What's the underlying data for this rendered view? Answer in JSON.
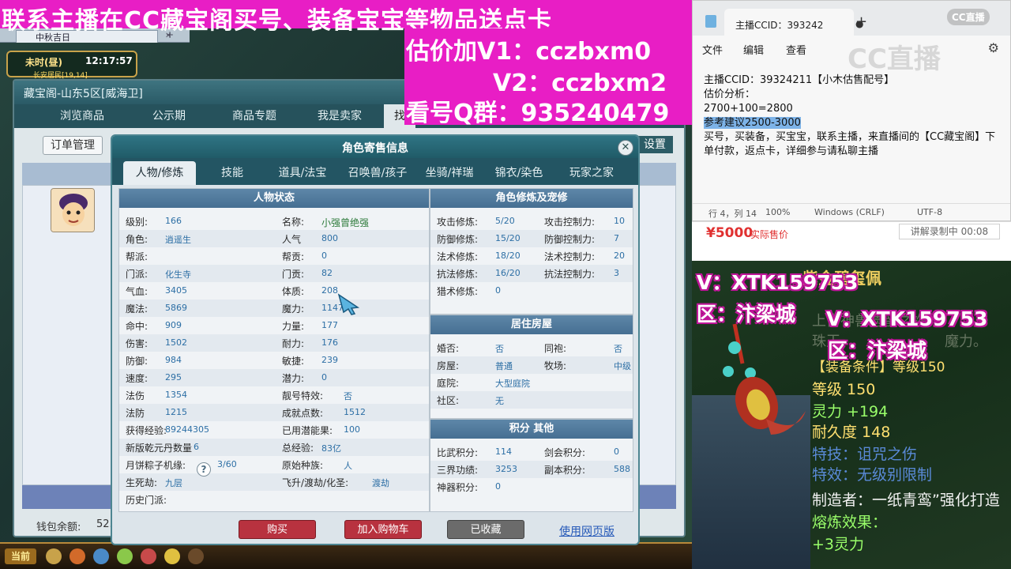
{
  "banner": {
    "title": "联系主播在CC藏宝阁买号、装备宝宝等物品送点卡",
    "price_v1": "估价加V1：cczbxm0",
    "price_v2": "V2：cczbxm2",
    "qq_group": "看号Q群：935240479"
  },
  "game": {
    "client_tab": "中秋吉日",
    "clock_period": "未时(昼)",
    "clock_time": "12:17:57",
    "location": "长安居民[19,14]",
    "market": {
      "title": "藏宝阁-山东5区[威海卫]",
      "tabs": [
        "浏览商品",
        "公示期",
        "商品专题",
        "我是卖家",
        "找"
      ],
      "order_button": "订单管理",
      "settings_button": "设置",
      "wallet_label": "钱包余额:",
      "wallet_value": "52."
    },
    "hud_now": "当前",
    "hud_colors": [
      "#c8a24a",
      "#d26a2a",
      "#4a8ac8",
      "#8ac84a",
      "#c84a4a",
      "#e0c040",
      "#6a4a2a"
    ]
  },
  "dialog": {
    "title": "角色寄售信息",
    "tabs": [
      "人物/修炼",
      "技能",
      "道具/法宝",
      "召唤兽/孩子",
      "坐骑/祥瑞",
      "锦衣/染色",
      "玩家之家"
    ],
    "status_title": "人物状态",
    "status_left": [
      {
        "label": "级别:",
        "value": "166"
      },
      {
        "label": "角色:",
        "value": "逍遥生"
      },
      {
        "label": "帮派:",
        "value": ""
      },
      {
        "label": "门派:",
        "value": "化生寺"
      },
      {
        "label": "气血:",
        "value": "3405"
      },
      {
        "label": "魔法:",
        "value": "5869"
      },
      {
        "label": "命中:",
        "value": "909"
      },
      {
        "label": "伤害:",
        "value": "1502"
      },
      {
        "label": "防御:",
        "value": "984"
      },
      {
        "label": "速度:",
        "value": "295"
      },
      {
        "label": "法伤",
        "value": "1354"
      },
      {
        "label": "法防",
        "value": "1215"
      },
      {
        "label": "获得经验:",
        "value": "89244305"
      },
      {
        "label": "新版乾元丹数量",
        "value": "6"
      },
      {
        "label": "月饼粽子机缘:",
        "value": "3/60"
      },
      {
        "label": "生死劫:",
        "value": "九层"
      },
      {
        "label": "历史门派:",
        "value": ""
      }
    ],
    "status_right": [
      {
        "label": "名称:",
        "value": "小强曾绝强"
      },
      {
        "label": "人气",
        "value": "800"
      },
      {
        "label": "帮贡:",
        "value": "0"
      },
      {
        "label": "门贡:",
        "value": "82"
      },
      {
        "label": "体质:",
        "value": "208"
      },
      {
        "label": "魔力:",
        "value": "1147"
      },
      {
        "label": "力量:",
        "value": "177"
      },
      {
        "label": "耐力:",
        "value": "176"
      },
      {
        "label": "敏捷:",
        "value": "239"
      },
      {
        "label": "潜力:",
        "value": "0"
      },
      {
        "label": "靓号特效:",
        "value": "否"
      },
      {
        "label": "成就点数:",
        "value": "1512"
      },
      {
        "label": "已用潜能果:",
        "value": "100"
      },
      {
        "label": "总经验:",
        "value": "83亿"
      },
      {
        "label": "原始种族:",
        "value": "人"
      },
      {
        "label": "飞升/渡劫/化圣:",
        "value": "渡劫"
      }
    ],
    "cultivation_title": "角色修炼及宠修",
    "cultivation": [
      {
        "l1": "攻击修炼:",
        "v1": "5/20",
        "l2": "攻击控制力:",
        "v2": "10"
      },
      {
        "l1": "防御修炼:",
        "v1": "15/20",
        "l2": "防御控制力:",
        "v2": "7"
      },
      {
        "l1": "法术修炼:",
        "v1": "18/20",
        "l2": "法术控制力:",
        "v2": "20"
      },
      {
        "l1": "抗法修炼:",
        "v1": "16/20",
        "l2": "抗法控制力:",
        "v2": "3"
      },
      {
        "l1": "猎术修炼:",
        "v1": "0",
        "l2": "",
        "v2": ""
      }
    ],
    "house_title": "居住房屋",
    "house": [
      {
        "l1": "婚否:",
        "v1": "否",
        "l2": "同袍:",
        "v2": "否"
      },
      {
        "l1": "房屋:",
        "v1": "普通",
        "l2": "牧场:",
        "v2": "中级"
      },
      {
        "l1": "庭院:",
        "v1": "大型庭院",
        "l2": "",
        "v2": ""
      },
      {
        "l1": "社区:",
        "v1": "无",
        "l2": "",
        "v2": ""
      }
    ],
    "points_title": "积分 其他",
    "points": [
      {
        "l1": "比武积分:",
        "v1": "114",
        "l2": "剑会积分:",
        "v2": "0"
      },
      {
        "l1": "三界功绩:",
        "v1": "3253",
        "l2": "副本积分:",
        "v2": "588"
      },
      {
        "l1": "神器积分:",
        "v1": "0",
        "l2": "",
        "v2": ""
      }
    ],
    "buy": "购买",
    "add_cart": "加入购物车",
    "favorited": "已收藏",
    "web_version": "使用网页版"
  },
  "notepad": {
    "tab_title": "主播CCID：393242",
    "menu": [
      "文件",
      "编辑",
      "查看"
    ],
    "logo": "CC直播",
    "watermark": "CC直播",
    "lines": [
      "主播CCID：39324211【小木估售配号】",
      "估价分析：",
      "2700+100=2800",
      "参考建议2500-3000",
      "买号，买装备，买宝宝，联系主播，来直播间的【CC藏宝阁】下单付款，返点卡，详细参与请私聊主播"
    ],
    "status": {
      "pos": "行 4，列 14",
      "zoom": "100%",
      "eol": "Windows (CRLF)",
      "enc": "UTF-8"
    }
  },
  "price_strip": {
    "price": "¥5000",
    "label": "实际售价",
    "note": "讲解录制中  00:08"
  },
  "item_view": {
    "overlay_v1": "V：XTK159753",
    "overlay_area1": "区：汴梁城",
    "overlay_v2": "V：XTK159753",
    "overlay_area2": "区：汴梁城",
    "item_name": "紫金碧玺佩",
    "desc1": "上古神兽遗留之物，",
    "desc2": "珠玉",
    "desc3": "魔力。",
    "req": "【装备条件】等级150",
    "level": "等级 150",
    "spirit": "灵力 +194",
    "durability": "耐久度 148",
    "sp1": "特技：诅咒之伤",
    "sp2": "特效：无级别限制",
    "maker": "制造者：一纸青鸾”强化打造",
    "melt": "熔炼效果：",
    "melt_val": "+3灵力"
  }
}
